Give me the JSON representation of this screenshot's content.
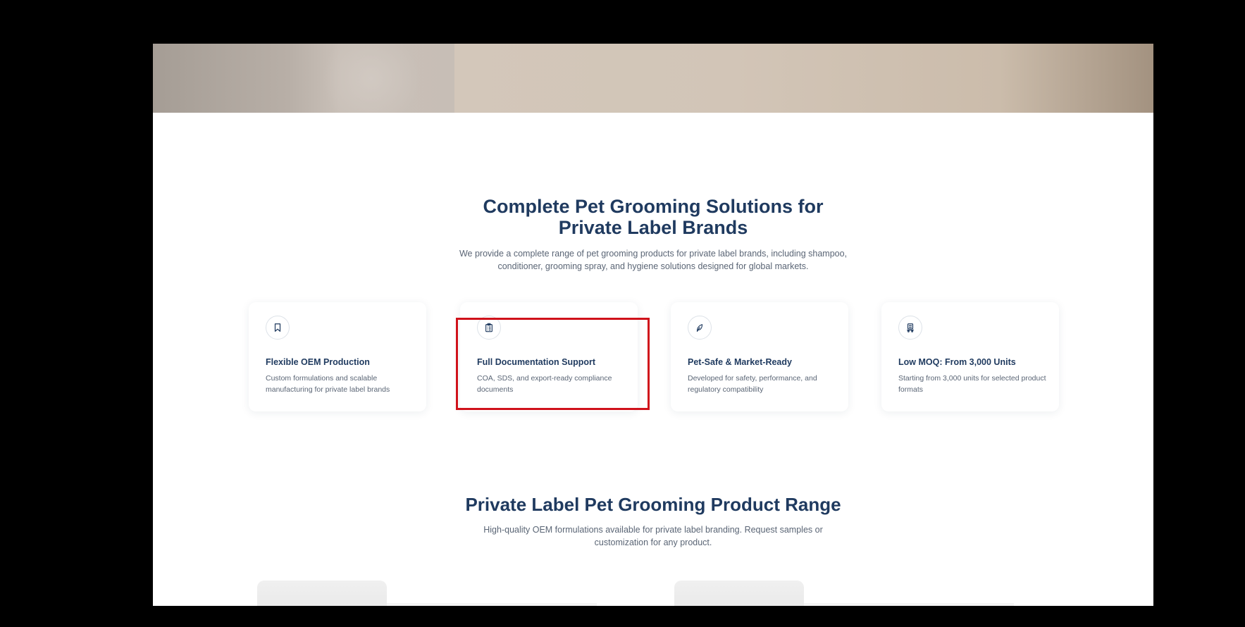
{
  "solutions": {
    "title_line1": "Complete Pet Grooming Solutions for",
    "title_line2": "Private Label Brands",
    "desc_line1": "We provide a complete range of pet grooming products for private label brands, including shampoo,",
    "desc_line2": "conditioner, grooming spray, and hygiene solutions designed for global markets."
  },
  "features": [
    {
      "icon": "bookmark-icon",
      "title": "Flexible OEM Production",
      "desc": "Custom formulations and scalable manufacturing for private label brands"
    },
    {
      "icon": "clipboard-icon",
      "title": "Full Documentation Support",
      "desc": "COA, SDS, and export-ready compliance documents"
    },
    {
      "icon": "shield-leaf-icon",
      "title": "Pet-Safe & Market-Ready",
      "desc": "Developed for safety, performance, and regulatory compatibility"
    },
    {
      "icon": "dolly-icon",
      "title": "Low MOQ: From 3,000 Units",
      "desc": "Starting from 3,000 units for selected product formats"
    }
  ],
  "product_range": {
    "title": "Private Label Pet Grooming Product Range",
    "desc_line1": "High-quality OEM formulations available for private label branding. Request samples or",
    "desc_line2": "customization for any product."
  },
  "colors": {
    "heading": "#1f3a5f",
    "body_text": "#5a6575",
    "highlight": "#d0121b",
    "background": "#ffffff",
    "frame": "#000000"
  }
}
